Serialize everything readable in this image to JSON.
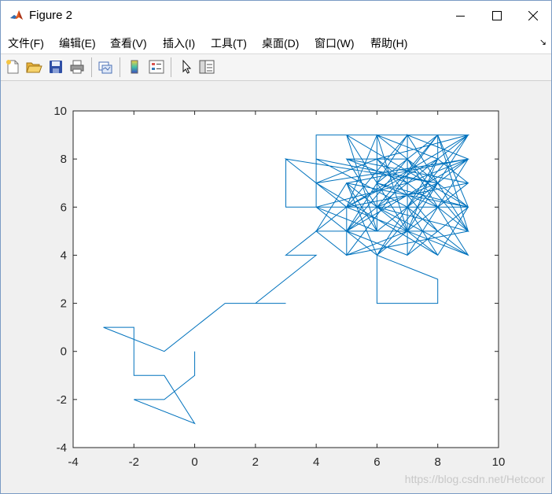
{
  "window": {
    "title": "Figure 2",
    "app_icon": "matlab-logo-icon",
    "controls": [
      "minimize-icon",
      "maximize-icon",
      "close-icon"
    ]
  },
  "menu": {
    "items": [
      {
        "label": "文件(F)"
      },
      {
        "label": "编辑(E)"
      },
      {
        "label": "查看(V)"
      },
      {
        "label": "插入(I)"
      },
      {
        "label": "工具(T)"
      },
      {
        "label": "桌面(D)"
      },
      {
        "label": "窗口(W)"
      },
      {
        "label": "帮助(H)"
      }
    ],
    "corner_glyph": "↘"
  },
  "toolbar": {
    "buttons": [
      "new-figure-icon",
      "open-file-icon",
      "save-icon",
      "print-icon",
      "link-plot-icon",
      "insert-colorbar-icon",
      "insert-legend-icon",
      "edit-plot-arrow-icon",
      "property-inspector-icon"
    ]
  },
  "watermark": "https://blog.csdn.net/Hetcoor",
  "chart_data": {
    "type": "line",
    "title": "",
    "xlabel": "",
    "ylabel": "",
    "xlim": [
      -4,
      10
    ],
    "ylim": [
      -4,
      10
    ],
    "xticks": [
      -4,
      -2,
      0,
      2,
      4,
      6,
      8,
      10
    ],
    "yticks": [
      -4,
      -2,
      0,
      2,
      4,
      6,
      8,
      10
    ],
    "grid": false,
    "color": "#0072bd",
    "path": [
      [
        0,
        0
      ],
      [
        0,
        -1
      ],
      [
        -1,
        -2
      ],
      [
        -2,
        -2
      ],
      [
        0,
        -3
      ],
      [
        -1,
        -1
      ],
      [
        -2,
        -1
      ],
      [
        -2,
        1
      ],
      [
        -3,
        1
      ],
      [
        -1,
        0
      ],
      [
        1,
        2
      ],
      [
        3,
        2
      ],
      [
        2,
        2
      ],
      [
        4,
        4
      ],
      [
        3,
        4
      ],
      [
        5,
        6
      ],
      [
        3,
        6
      ],
      [
        3,
        8
      ],
      [
        5,
        6
      ],
      [
        5,
        4
      ],
      [
        4,
        5
      ],
      [
        6,
        5
      ],
      [
        4,
        6
      ],
      [
        4,
        9
      ],
      [
        7,
        9
      ],
      [
        5,
        6
      ],
      [
        9,
        9
      ],
      [
        5,
        9
      ],
      [
        6,
        5
      ],
      [
        6,
        9
      ],
      [
        9,
        6
      ],
      [
        5,
        7
      ],
      [
        6,
        4
      ],
      [
        8,
        3
      ],
      [
        8,
        2
      ],
      [
        6,
        2
      ],
      [
        6,
        4
      ],
      [
        8,
        8
      ],
      [
        8,
        9
      ],
      [
        6,
        7
      ],
      [
        5,
        5
      ],
      [
        9,
        8
      ],
      [
        4,
        7
      ],
      [
        6,
        8
      ],
      [
        8,
        5
      ],
      [
        7,
        4
      ],
      [
        7,
        9
      ],
      [
        9,
        5
      ],
      [
        5,
        4
      ],
      [
        8,
        9
      ],
      [
        6,
        6
      ],
      [
        9,
        4
      ],
      [
        7,
        6
      ],
      [
        4,
        8
      ],
      [
        8,
        7
      ],
      [
        7,
        5
      ],
      [
        9,
        9
      ],
      [
        6,
        8
      ],
      [
        8,
        6
      ],
      [
        9,
        7
      ],
      [
        5,
        8
      ],
      [
        7,
        8
      ],
      [
        9,
        5
      ],
      [
        6,
        6
      ],
      [
        4,
        6
      ],
      [
        7,
        7
      ],
      [
        9,
        8
      ],
      [
        6,
        5
      ],
      [
        5,
        7
      ],
      [
        8,
        4
      ],
      [
        9,
        6
      ],
      [
        5,
        9
      ],
      [
        7,
        5
      ],
      [
        8,
        8
      ],
      [
        5,
        6
      ],
      [
        9,
        7
      ],
      [
        6,
        4
      ],
      [
        8,
        7
      ],
      [
        7,
        9
      ],
      [
        9,
        8
      ],
      [
        7,
        4
      ],
      [
        8,
        6
      ],
      [
        6,
        7
      ],
      [
        9,
        6
      ],
      [
        8,
        5
      ],
      [
        5,
        5
      ],
      [
        7,
        8
      ],
      [
        9,
        4
      ],
      [
        5,
        6
      ],
      [
        6,
        9
      ],
      [
        8,
        9
      ],
      [
        9,
        5
      ],
      [
        7,
        7
      ],
      [
        5,
        8
      ],
      [
        6,
        6
      ],
      [
        8,
        7
      ],
      [
        3,
        8
      ],
      [
        4,
        7
      ],
      [
        8,
        4
      ],
      [
        7,
        6
      ],
      [
        9,
        9
      ],
      [
        5,
        5
      ],
      [
        6,
        4
      ],
      [
        9,
        7
      ],
      [
        8,
        8
      ],
      [
        6,
        9
      ],
      [
        7,
        5
      ],
      [
        5,
        4
      ],
      [
        4,
        5
      ],
      [
        5,
        7
      ],
      [
        9,
        8
      ],
      [
        7,
        9
      ],
      [
        6,
        7
      ],
      [
        8,
        9
      ],
      [
        9,
        6
      ],
      [
        4,
        6
      ],
      [
        5,
        5
      ],
      [
        7,
        4
      ],
      [
        8,
        5
      ],
      [
        9,
        4
      ]
    ]
  }
}
